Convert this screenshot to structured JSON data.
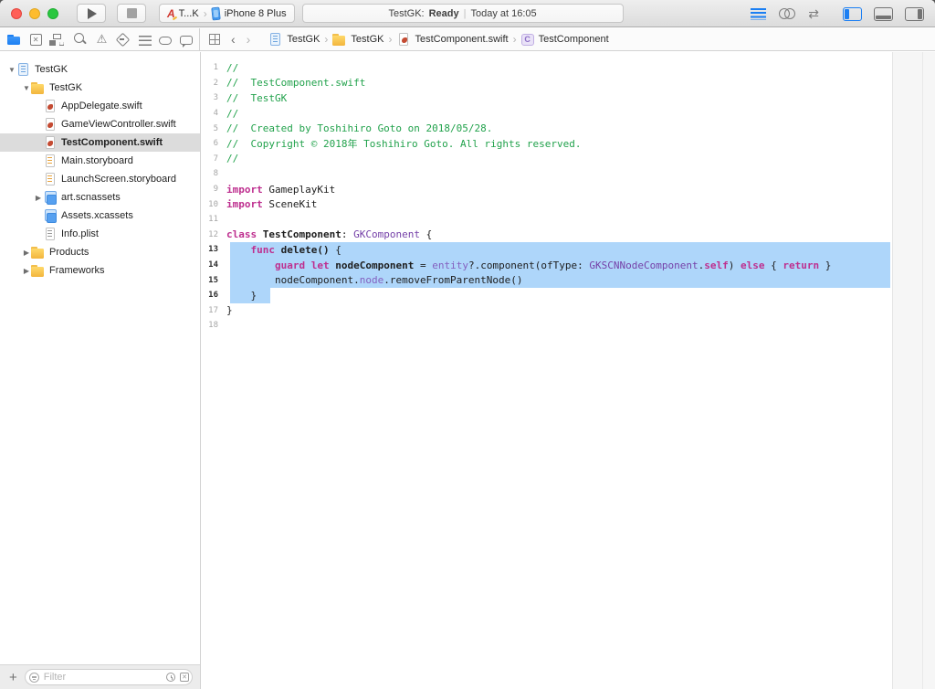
{
  "colors": {
    "accent_blue": "#1b7ff3",
    "selection_blue": "#aed6fa",
    "sidebar_selection_gray": "#dcdcdc",
    "syntax_comment_green": "#22a24c",
    "syntax_keyword_pink": "#be2f8f",
    "syntax_type_purple": "#7540a8",
    "syntax_property_purple": "#8460bf",
    "traffic_red": "#ff5f57",
    "traffic_yellow": "#febc2e",
    "traffic_green": "#29c73f"
  },
  "glyphs": {
    "chevron": "›",
    "back": "‹",
    "forward": "›",
    "version_arrows": "⇄",
    "warning": "⚠",
    "box_x": "✕"
  },
  "toolbar": {
    "scheme": {
      "app_name": "T...K",
      "device": "iPhone 8 Plus"
    },
    "status": {
      "project": "TestGK:",
      "state": "Ready",
      "separator": "|",
      "time": "Today at 16:05"
    }
  },
  "navbar": {
    "icons": [
      {
        "name": "project-navigator-icon",
        "cls": "ni-project",
        "active": true
      },
      {
        "name": "source-control-navigator-icon",
        "cls": "ni-sc"
      },
      {
        "name": "symbol-navigator-icon",
        "cls": "ni-symbol"
      },
      {
        "name": "find-navigator-icon",
        "cls": "ni-find"
      },
      {
        "name": "issue-navigator-icon",
        "cls": "ni-issue",
        "glyph": "⚠"
      },
      {
        "name": "test-navigator-icon",
        "cls": "ni-test"
      },
      {
        "name": "debug-navigator-icon",
        "cls": "ni-debug"
      },
      {
        "name": "breakpoint-navigator-icon",
        "cls": "ni-bp"
      },
      {
        "name": "report-navigator-icon",
        "cls": "ni-report"
      }
    ]
  },
  "jumpbar": {
    "items": [
      {
        "icon": "project",
        "label": "TestGK"
      },
      {
        "icon": "folder",
        "label": "TestGK"
      },
      {
        "icon": "swift",
        "label": "TestComponent.swift"
      },
      {
        "icon": "class",
        "badge": "C",
        "label": "TestComponent"
      }
    ]
  },
  "sidebar": {
    "tree": [
      {
        "level": 0,
        "disclosure": "open",
        "icon": "project",
        "label": "TestGK"
      },
      {
        "level": 1,
        "disclosure": "open",
        "icon": "folder",
        "label": "TestGK"
      },
      {
        "level": 2,
        "icon": "swift",
        "label": "AppDelegate.swift"
      },
      {
        "level": 2,
        "icon": "swift",
        "label": "GameViewController.swift"
      },
      {
        "level": 2,
        "icon": "swift",
        "label": "TestComponent.swift",
        "selected": true
      },
      {
        "level": 2,
        "icon": "storyboard",
        "label": "Main.storyboard"
      },
      {
        "level": 2,
        "icon": "storyboard",
        "label": "LaunchScreen.storyboard"
      },
      {
        "level": 2,
        "disclosure": "closed",
        "icon": "assets",
        "label": "art.scnassets"
      },
      {
        "level": 2,
        "icon": "assets",
        "label": "Assets.xcassets"
      },
      {
        "level": 2,
        "icon": "plist",
        "label": "Info.plist"
      },
      {
        "level": 1,
        "disclosure": "closed",
        "icon": "folder",
        "label": "Products"
      },
      {
        "level": 1,
        "disclosure": "closed",
        "icon": "folder",
        "label": "Frameworks"
      }
    ],
    "filter": {
      "placeholder": "Filter",
      "add_label": "+"
    }
  },
  "editor": {
    "lines": [
      {
        "n": 1,
        "tokens": [
          {
            "t": "//",
            "c": "comment"
          }
        ]
      },
      {
        "n": 2,
        "tokens": [
          {
            "t": "//  TestComponent.swift",
            "c": "comment"
          }
        ]
      },
      {
        "n": 3,
        "tokens": [
          {
            "t": "//  TestGK",
            "c": "comment"
          }
        ]
      },
      {
        "n": 4,
        "tokens": [
          {
            "t": "//",
            "c": "comment"
          }
        ]
      },
      {
        "n": 5,
        "tokens": [
          {
            "t": "//  Created by Toshihiro Goto on 2018/05/28.",
            "c": "comment"
          }
        ]
      },
      {
        "n": 6,
        "tokens": [
          {
            "t": "//  Copyright © 2018年 Toshihiro Goto. All rights reserved.",
            "c": "comment"
          }
        ]
      },
      {
        "n": 7,
        "tokens": [
          {
            "t": "//",
            "c": "comment"
          }
        ]
      },
      {
        "n": 8,
        "tokens": []
      },
      {
        "n": 9,
        "tokens": [
          {
            "t": "import",
            "c": "kw"
          },
          {
            "t": " GameplayKit",
            "c": "plain"
          }
        ]
      },
      {
        "n": 10,
        "tokens": [
          {
            "t": "import",
            "c": "kw"
          },
          {
            "t": " SceneKit",
            "c": "plain"
          }
        ]
      },
      {
        "n": 11,
        "tokens": []
      },
      {
        "n": 12,
        "tokens": [
          {
            "t": "class",
            "c": "kw"
          },
          {
            "t": " ",
            "c": "plain"
          },
          {
            "t": "TestComponent",
            "c": "decl"
          },
          {
            "t": ": ",
            "c": "plain"
          },
          {
            "t": "GKComponent",
            "c": "type"
          },
          {
            "t": " {",
            "c": "plain"
          }
        ]
      },
      {
        "n": 13,
        "sel": "full",
        "tokens": [
          {
            "t": "    ",
            "c": "plain"
          },
          {
            "t": "func",
            "c": "kw"
          },
          {
            "t": " ",
            "c": "plain"
          },
          {
            "t": "delete()",
            "c": "decl"
          },
          {
            "t": " {",
            "c": "plain"
          }
        ]
      },
      {
        "n": 14,
        "sel": "full",
        "tokens": [
          {
            "t": "        ",
            "c": "plain"
          },
          {
            "t": "guard",
            "c": "kw"
          },
          {
            "t": " ",
            "c": "plain"
          },
          {
            "t": "let",
            "c": "kw"
          },
          {
            "t": " ",
            "c": "plain"
          },
          {
            "t": "nodeComponent",
            "c": "decl"
          },
          {
            "t": " = ",
            "c": "plain"
          },
          {
            "t": "entity",
            "c": "prop"
          },
          {
            "t": "?.component(ofType: ",
            "c": "plain"
          },
          {
            "t": "GKSCNNodeComponent",
            "c": "type"
          },
          {
            "t": ".",
            "c": "plain"
          },
          {
            "t": "self",
            "c": "kw"
          },
          {
            "t": ") ",
            "c": "plain"
          },
          {
            "t": "else",
            "c": "kw"
          },
          {
            "t": " { ",
            "c": "plain"
          },
          {
            "t": "return",
            "c": "kw"
          },
          {
            "t": " }",
            "c": "plain"
          }
        ]
      },
      {
        "n": 15,
        "sel": "full",
        "tokens": [
          {
            "t": "        ",
            "c": "plain"
          },
          {
            "t": "nodeComponent",
            "c": "plain"
          },
          {
            "t": ".",
            "c": "plain"
          },
          {
            "t": "node",
            "c": "prop"
          },
          {
            "t": ".removeFromParentNode()",
            "c": "plain"
          }
        ]
      },
      {
        "n": 16,
        "sel": "part",
        "tokens": [
          {
            "t": "    }",
            "c": "plain"
          }
        ]
      },
      {
        "n": 17,
        "tokens": [
          {
            "t": "}",
            "c": "plain"
          }
        ]
      },
      {
        "n": 18,
        "tokens": []
      }
    ]
  }
}
